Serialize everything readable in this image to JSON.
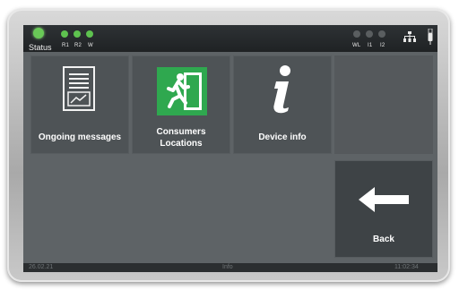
{
  "status_bar": {
    "status_label": "Status",
    "indicators": [
      {
        "label": "R1",
        "color": "#5ec24f"
      },
      {
        "label": "R2",
        "color": "#5ec24f"
      },
      {
        "label": "W",
        "color": "#5ec24f"
      }
    ],
    "right_indicators": [
      {
        "label": "WL"
      },
      {
        "label": "I1"
      },
      {
        "label": "I2"
      }
    ],
    "network_icon": "network-icon",
    "usb_icon": "usb-icon"
  },
  "tiles": [
    {
      "label": "Ongoing messages",
      "icon": "report-document-icon"
    },
    {
      "label_line1": "Consumers",
      "label_line2": "Locations",
      "icon": "emergency-exit-icon"
    },
    {
      "label": "Device info",
      "icon": "info-icon"
    }
  ],
  "back": {
    "label": "Back",
    "icon": "left-arrow-icon"
  },
  "bottom_bar": {
    "left": "26.02.21",
    "center": "Info",
    "right": "11:02:34"
  },
  "colors": {
    "status_green": "#5ec24f",
    "exit_sign_green": "#2fa84f",
    "screen_bg": "#5e6366",
    "tile_bg": "#4e5356"
  }
}
